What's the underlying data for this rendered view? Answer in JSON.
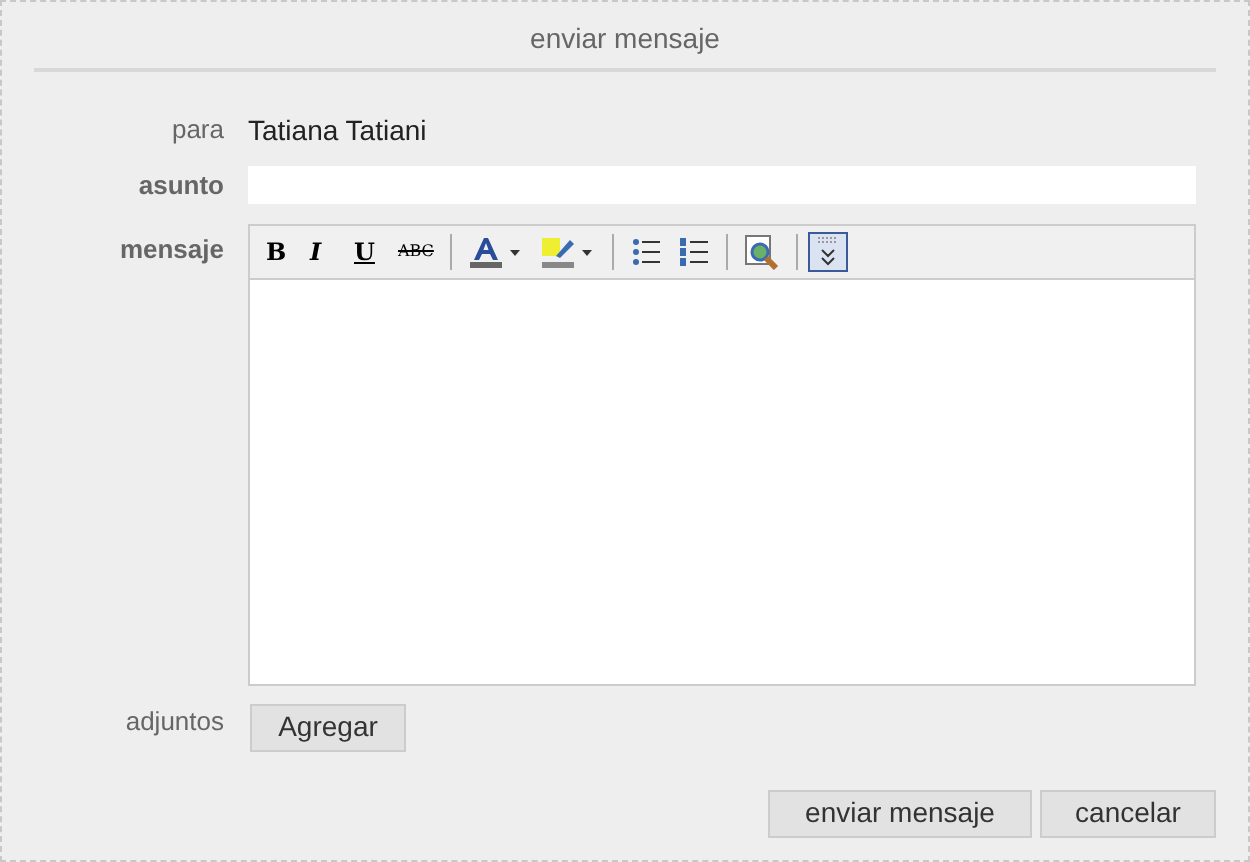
{
  "window": {
    "title": "enviar mensaje"
  },
  "fields": [
    {
      "label": "para",
      "bold": false,
      "kind": "text",
      "value": "Tatiana Tatiani"
    },
    {
      "label": "asunto",
      "bold": true,
      "kind": "input"
    },
    {
      "label": "mensaje",
      "bold": true,
      "kind": "editor"
    }
  ],
  "toolbar": [
    {
      "kind": "bold",
      "label": "B",
      "active": false
    },
    {
      "kind": "italic",
      "label": "I",
      "active": false
    },
    {
      "kind": "underline",
      "label": "U",
      "active": false
    },
    {
      "kind": "strike",
      "label": "ABC",
      "active": false
    },
    {
      "kind": "sep"
    },
    {
      "kind": "forecolor",
      "active": false
    },
    {
      "kind": "highlight",
      "active": false
    },
    {
      "kind": "sep"
    },
    {
      "kind": "bullets",
      "active": false
    },
    {
      "kind": "numbers",
      "active": false
    },
    {
      "kind": "sep"
    },
    {
      "kind": "preview",
      "active": false
    },
    {
      "kind": "sep"
    },
    {
      "kind": "expand",
      "active": true
    }
  ],
  "attachments": {
    "label": "adjuntos",
    "button": "Agregar"
  },
  "buttons": [
    "enviar mensaje",
    "cancelar"
  ]
}
